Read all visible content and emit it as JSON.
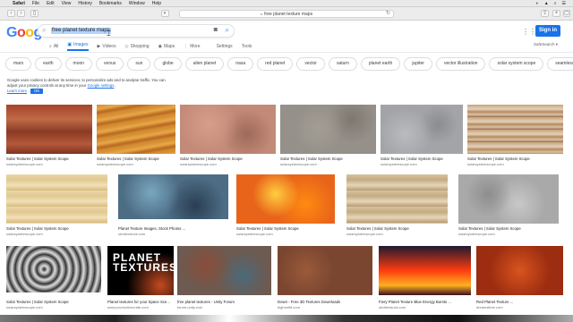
{
  "menubar": {
    "apple": "",
    "items": [
      "Safari",
      "File",
      "Edit",
      "View",
      "History",
      "Bookmarks",
      "Window",
      "Help"
    ],
    "status": [
      "◐",
      "▲",
      "⌕",
      "☰"
    ]
  },
  "browser": {
    "url": "free planet texture maps",
    "url_prefix": "a"
  },
  "google": {
    "logo": [
      "G",
      "o",
      "o",
      "g",
      "l",
      "e"
    ],
    "query": "free planet texture maps",
    "tabs": [
      {
        "icon": "⌕",
        "label": "All"
      },
      {
        "icon": "▣",
        "label": "Images"
      },
      {
        "icon": "▶",
        "label": "Videos"
      },
      {
        "icon": "◇",
        "label": "Shopping"
      },
      {
        "icon": "◉",
        "label": "Maps"
      },
      {
        "icon": "⋮",
        "label": "More"
      },
      {
        "icon": "",
        "label": "Settings"
      },
      {
        "icon": "",
        "label": "Tools"
      }
    ],
    "signin": "Sign in",
    "safesearch": "SafeSearch ▾",
    "chips": [
      "mars",
      "earth",
      "moon",
      "venus",
      "sun",
      "globe",
      "alien planet",
      "nasa",
      "red planet",
      "vector",
      "saturn",
      "planet earth",
      "jupiter",
      "vector illustration",
      "solar system scope",
      "seamless"
    ],
    "cookie": {
      "text": "Google uses cookies to deliver its services, to personalize ads and to analyse traffic. You can adjust your privacy controls at any time in your",
      "link": "Google settings",
      "learn": "Learn more",
      "ok": "OK"
    }
  },
  "results": [
    {
      "title": "Solar Textures | Solar System Scope",
      "src": "solarsystemscope.com"
    },
    {
      "title": "Solar Textures | Solar System Scope",
      "src": "solarsystemscope.com"
    },
    {
      "title": "Solar Textures | Solar System Scope",
      "src": "solarsystemscope.com"
    },
    {
      "title": "Solar Textures | Solar System Scope",
      "src": "solarsystemscope.com"
    },
    {
      "title": "Solar Textures | Solar System Scope",
      "src": "solarsystemscope.com"
    },
    {
      "title": "Solar Textures | Solar System Scope",
      "src": "solarsystemscope.com"
    },
    {
      "title": "Solar Textures | Solar System Scope",
      "src": "solarsystemscope.com"
    },
    {
      "title": "Planet Texture Images, Stock Photos ...",
      "src": "shutterstock.com"
    },
    {
      "title": "Solar Textures | Solar System Scope",
      "src": "solarsystemscope.com"
    },
    {
      "title": "Solar Textures | Solar System Scope",
      "src": "solarsystemscope.com"
    },
    {
      "title": "Solar Textures | Solar System Scope",
      "src": "solarsystemscope.com"
    },
    {
      "title": "Solar Textures | Solar System Scope",
      "src": "solarsystemscope.com"
    },
    {
      "title": "Planet textures for your Space Sce...",
      "src": "www.productioncrate.com"
    },
    {
      "title": "free planet textures - Unity Forum",
      "src": "forum.unity.com"
    },
    {
      "title": "Down - Free 3D Textures Downloads",
      "src": "bighostfd.com"
    },
    {
      "title": "Fiery Planet Texture Blue Energy Bursts ...",
      "src": "shutterstock.com"
    },
    {
      "title": "Red Planet Texture ...",
      "src": "dreamstime.com"
    }
  ],
  "planet_card_text": "PLANET TEXTURES"
}
